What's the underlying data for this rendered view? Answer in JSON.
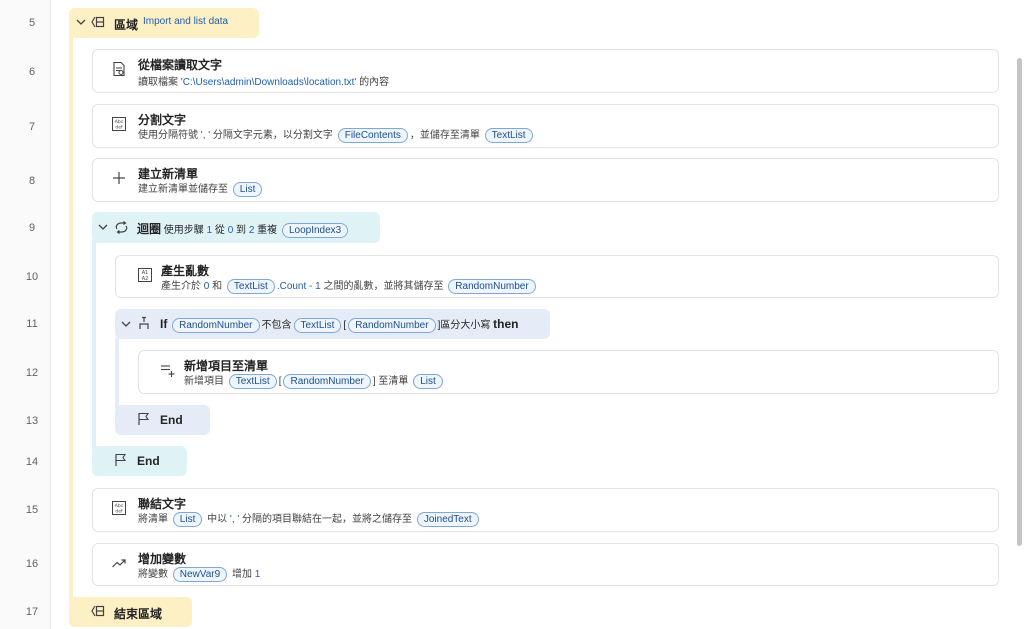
{
  "line_numbers": [
    "5",
    "6",
    "7",
    "8",
    "9",
    "10",
    "11",
    "12",
    "13",
    "14",
    "15",
    "16",
    "17"
  ],
  "region": {
    "title": "區域",
    "name": "Import and list data",
    "end_title": "結束區域"
  },
  "steps": {
    "read_file": {
      "title": "從檔案讀取文字",
      "desc_prefix": "讀取檔案 ",
      "path": "'C:\\Users\\admin\\Downloads\\location.txt'",
      "desc_suffix": " 的內容"
    },
    "split_text": {
      "title": "分割文字",
      "desc_prefix": "使用分隔符號 ",
      "separator": "', '",
      "desc_mid": " 分隔文字元素，以分割文字 ",
      "var1": "FileContents",
      "desc_mid2": "，並儲存至清單 ",
      "var2": "TextList"
    },
    "new_list": {
      "title": "建立新清單",
      "desc_prefix": "建立新清單並儲存至 ",
      "var": "List"
    },
    "loop": {
      "title": "迴圈",
      "text1": "使用步驟 ",
      "step": "1",
      "text2": " 從 ",
      "from": "0",
      "text3": " 到 ",
      "to": "2",
      "text4": " 重複 ",
      "var": "LoopIndex3"
    },
    "random": {
      "title": "產生亂數",
      "text1": "產生介於 ",
      "min": "0",
      "text2": " 和 ",
      "var1": "TextList",
      "text3": ".Count - ",
      "num": "1",
      "text4": " 之間的亂數，並將其儲存至 ",
      "var2": "RandomNumber"
    },
    "if": {
      "keyword": "If",
      "var1": "RandomNumber",
      "text1": "不包含",
      "var2": "TextList",
      "bracket_open": "[",
      "var3": "RandomNumber",
      "bracket_close": "]",
      "text2": "區分大小寫 ",
      "then": "then"
    },
    "add_item": {
      "title": "新增項目至清單",
      "text1": "新增項目 ",
      "var1": "TextList",
      "bracket_open": "[",
      "var2": "RandomNumber",
      "text2": "] 至清單 ",
      "var3": "List"
    },
    "if_end": {
      "label": "End"
    },
    "loop_end": {
      "label": "End"
    },
    "join_text": {
      "title": "聯結文字",
      "text1": "將清單 ",
      "var1": "List",
      "text2": " 中以 ",
      "separator": "', '",
      "text3": " 分隔的項目聯結在一起，並將之儲存至 ",
      "var2": "JoinedText"
    },
    "increase_var": {
      "title": "增加變數",
      "text1": "將變數 ",
      "var1": "NewVar9",
      "text2": " 增加 ",
      "amount": "1"
    }
  },
  "colors": {
    "region": "#fdf0c4",
    "loop": "#dff3f7",
    "if": "#e5ecf8",
    "accent": "#2060b0"
  }
}
